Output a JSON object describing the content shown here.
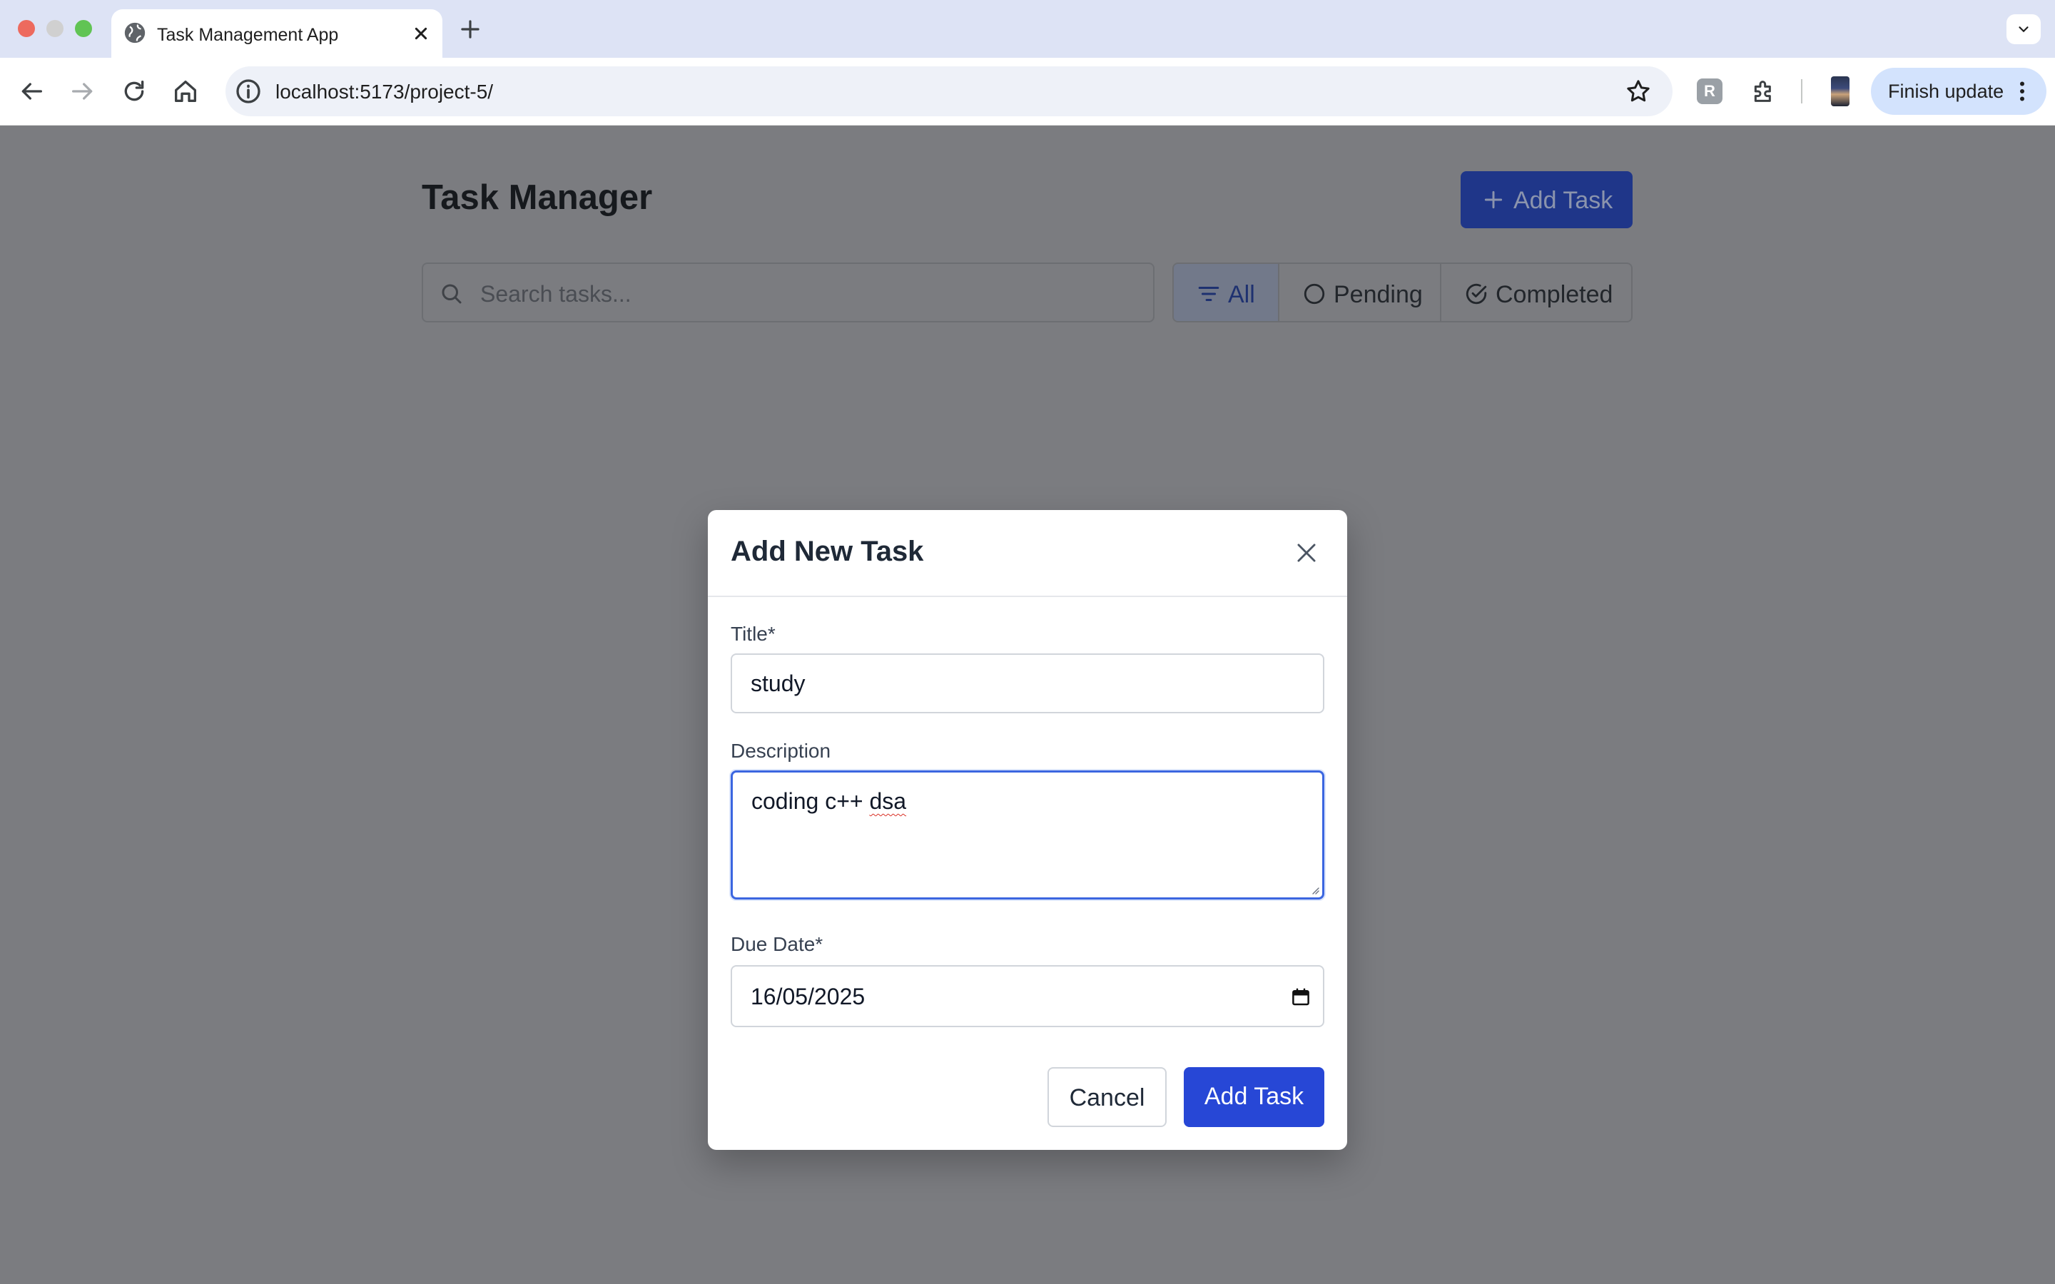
{
  "browser": {
    "tab_title": "Task Management App",
    "url": "localhost:5173/project-5/",
    "finish_update_label": "Finish update",
    "extension_badge": "R"
  },
  "app": {
    "title": "Task Manager",
    "add_task_label": "Add Task",
    "search": {
      "placeholder": "Search tasks..."
    },
    "filters": [
      {
        "label": "All",
        "icon": "filter-icon",
        "active": true
      },
      {
        "label": "Pending",
        "icon": "circle-icon",
        "active": false
      },
      {
        "label": "Completed",
        "icon": "check-circle-icon",
        "active": false
      }
    ]
  },
  "modal": {
    "title": "Add New Task",
    "fields": {
      "title": {
        "label": "Title*",
        "value": "study"
      },
      "description": {
        "label": "Description",
        "value_prefix": "coding c++ ",
        "value_flagged": "dsa"
      },
      "due_date": {
        "label": "Due Date*",
        "value": "16/05/2025"
      }
    },
    "cancel_label": "Cancel",
    "submit_label": "Add Task"
  },
  "colors": {
    "primary": "#2747d6",
    "focus_ring": "#3b66e0",
    "overlay": "#7b7c80"
  }
}
